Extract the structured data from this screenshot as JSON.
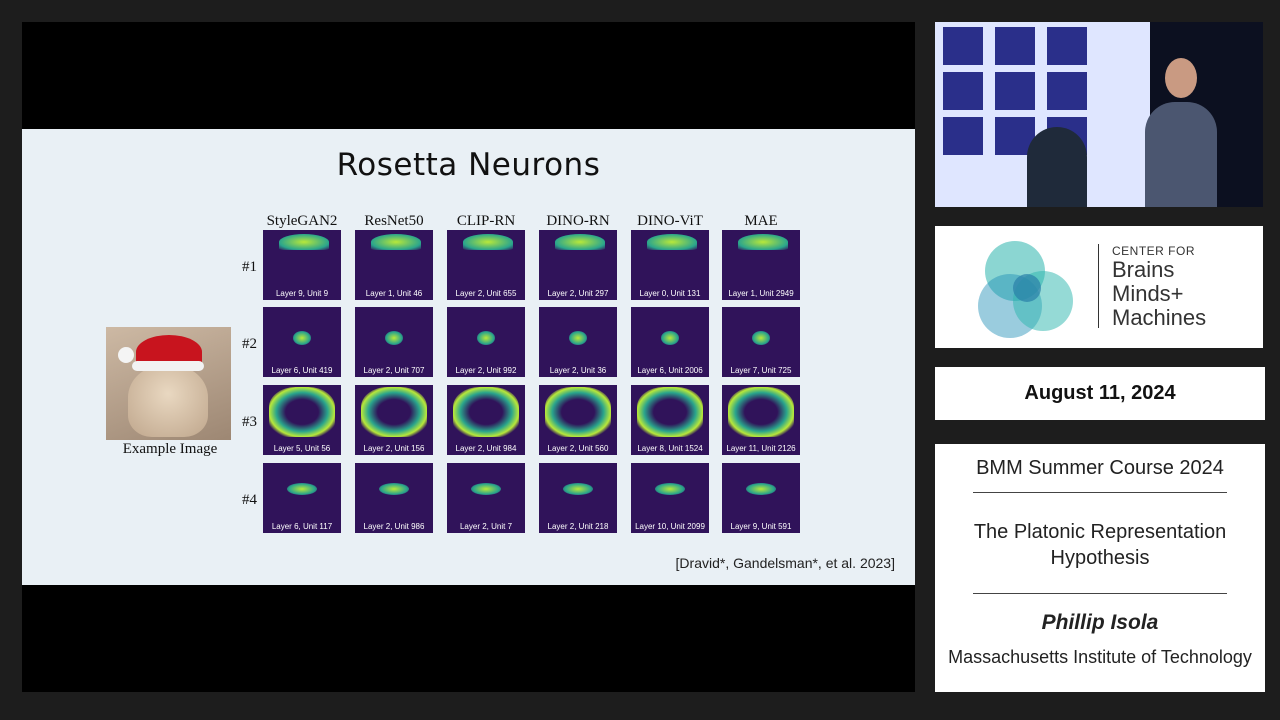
{
  "slide": {
    "title": "Rosetta Neurons",
    "models": [
      "StyleGAN2",
      "ResNet50",
      "CLIP-RN",
      "DINO-RN",
      "DINO-ViT",
      "MAE"
    ],
    "rows": [
      "#1",
      "#2",
      "#3",
      "#4"
    ],
    "example_caption": "Example Image",
    "citation": "[Dravid*, Gandelsman*, et al. 2023]",
    "captions": [
      [
        "Layer 9, Unit 9",
        "Layer 1, Unit 46",
        "Layer 2, Unit 655",
        "Layer 2, Unit 297",
        "Layer 0, Unit 131",
        "Layer 1, Unit 2949"
      ],
      [
        "Layer 6, Unit 419",
        "Layer 2, Unit 707",
        "Layer 2, Unit 992",
        "Layer 2, Unit 36",
        "Layer 6, Unit 2006",
        "Layer 7, Unit 725"
      ],
      [
        "Layer 5, Unit 56",
        "Layer 2, Unit 156",
        "Layer 2, Unit 984",
        "Layer 2, Unit 560",
        "Layer 8, Unit 1524",
        "Layer 11, Unit 2126"
      ],
      [
        "Layer 6, Unit 117",
        "Layer 2, Unit 986",
        "Layer 2, Unit 7",
        "Layer 2, Unit 218",
        "Layer 10, Unit 2099",
        "Layer 9, Unit 591"
      ]
    ]
  },
  "logo": {
    "line1": "CENTER FOR",
    "line2": "Brains",
    "line3": "Minds+",
    "line4": "Machines"
  },
  "date": "August 11, 2024",
  "info": {
    "course": "BMM Summer Course 2024",
    "talk": "The Platonic Representation Hypothesis",
    "speaker": "Phillip Isola",
    "institution": "Massachusetts Institute of Technology"
  },
  "colors": {
    "heatmap_bg": "#30135a",
    "heatmap_hot": "#b8e83a",
    "heatmap_mid": "#2aa58c",
    "logo_teal": "#2bb5ad"
  }
}
